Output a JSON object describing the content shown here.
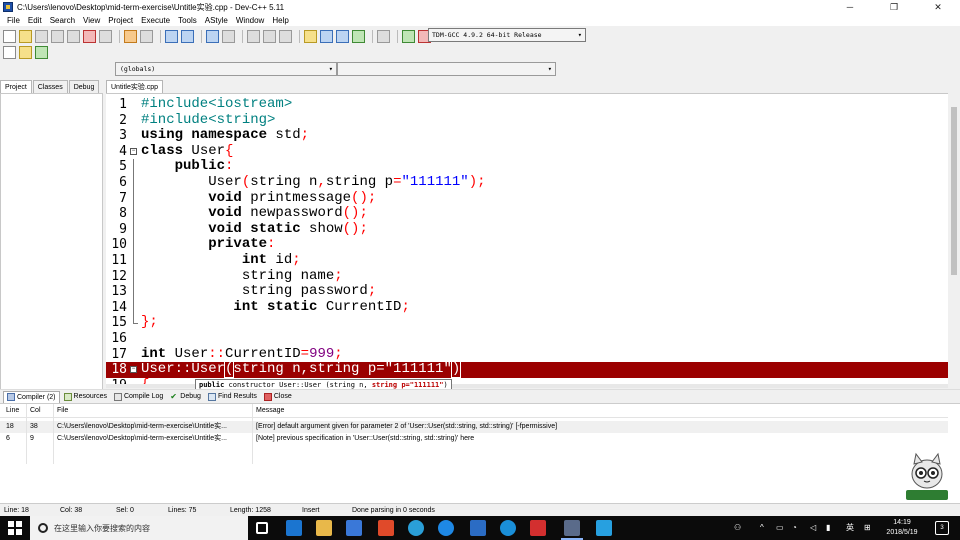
{
  "window": {
    "title": "C:\\Users\\lenovo\\Desktop\\mid-term-exercise\\Untitle实验.cpp - Dev-C++ 5.11",
    "minimize": "─",
    "maximize": "❐",
    "close": "✕"
  },
  "menu": [
    "File",
    "Edit",
    "Search",
    "View",
    "Project",
    "Execute",
    "Tools",
    "AStyle",
    "Window",
    "Help"
  ],
  "toolbar": {
    "compiler": "TDM-GCC 4.9.2 64-bit Release"
  },
  "scope": {
    "left": "(globals)",
    "right": ""
  },
  "left_tabs": [
    "Project",
    "Classes",
    "Debug"
  ],
  "editor_tab": "Untitle实验.cpp",
  "code": [
    {
      "n": "1"
    },
    {
      "n": "2"
    },
    {
      "n": "3"
    },
    {
      "n": "4"
    },
    {
      "n": "5"
    },
    {
      "n": "6"
    },
    {
      "n": "7"
    },
    {
      "n": "8"
    },
    {
      "n": "9"
    },
    {
      "n": "10"
    },
    {
      "n": "11"
    },
    {
      "n": "12"
    },
    {
      "n": "13"
    },
    {
      "n": "14"
    },
    {
      "n": "15"
    },
    {
      "n": "16"
    },
    {
      "n": "17"
    },
    {
      "n": "18"
    },
    {
      "n": "19"
    }
  ],
  "code_text": {
    "l1_a": "#include",
    "l1_b": "<iostream>",
    "l2_a": "#include",
    "l2_b": "<string>",
    "l3_a": "using namespace",
    "l3_b": " std",
    "l3_c": ";",
    "l4_a": "class",
    "l4_b": " User",
    "l4_c": "{",
    "l5_a": "    public",
    "l5_b": ":",
    "l6_a": "        User",
    "l6_b": "(",
    "l6_c": "string n",
    "l6_d": ",",
    "l6_e": "string p",
    "l6_f": "=",
    "l6_g": "\"111111\"",
    "l6_h": ");",
    "l7_a": "        void",
    "l7_b": " printmessage",
    "l7_c": "();",
    "l8_a": "        void",
    "l8_b": " newpassword",
    "l8_c": "();",
    "l9_a": "        void static",
    "l9_b": " show",
    "l9_c": "();",
    "l10_a": "        private",
    "l10_b": ":",
    "l11_a": "            int",
    "l11_b": " id",
    "l11_c": ";",
    "l12_a": "            string name",
    "l12_b": ";",
    "l13_a": "            string password",
    "l13_b": ";",
    "l14_a": "           int static",
    "l14_b": " CurrentID",
    "l14_c": ";",
    "l15_a": "}",
    "l15_b": ";",
    "l17_a": "int",
    "l17_b": " User",
    "l17_c": "::",
    "l17_d": "CurrentID",
    "l17_e": "=",
    "l17_f": "999",
    "l17_g": ";",
    "l18_a": "User::User",
    "l18_b": "(",
    "l18_c": "string n,string p=\"111111\"",
    "l18_d": ")",
    "l19_a": "{"
  },
  "tooltip": {
    "kw": "public",
    "text": " constructor User::User (string n, ",
    "param": "string p=\"111111\"",
    "end": ")"
  },
  "bottom_tabs": [
    "Compiler (2)",
    "Resources",
    "Compile Log",
    "Debug",
    "Find Results",
    "Close"
  ],
  "messages": {
    "headers": {
      "line": "Line",
      "col": "Col",
      "file": "File",
      "message": "Message"
    },
    "rows": [
      {
        "line": "18",
        "col": "38",
        "file": "C:\\Users\\lenovo\\Desktop\\mid-term-exercise\\Untitle实...",
        "message": "[Error] default argument given for parameter 2 of 'User::User(std::string, std::string)' [-fpermissive]"
      },
      {
        "line": "6",
        "col": "9",
        "file": "C:\\Users\\lenovo\\Desktop\\mid-term-exercise\\Untitle实...",
        "message": "[Note] previous specification in 'User::User(std::string, std::string)' here"
      }
    ]
  },
  "status": {
    "line": "Line:  18",
    "col": "Col:  38",
    "sel": "Sel:  0",
    "lines": "Lines:  75",
    "length": "Length:  1258",
    "mode": "Insert",
    "msg": "Done parsing in 0 seconds"
  },
  "taskbar": {
    "search_placeholder": "在这里输入你要搜索的内容",
    "ime": "英",
    "time": "14:19",
    "date": "2018/5/19",
    "notifications": "3"
  },
  "mascot": {
    "label": "英 · ✕ 🌙 操"
  }
}
